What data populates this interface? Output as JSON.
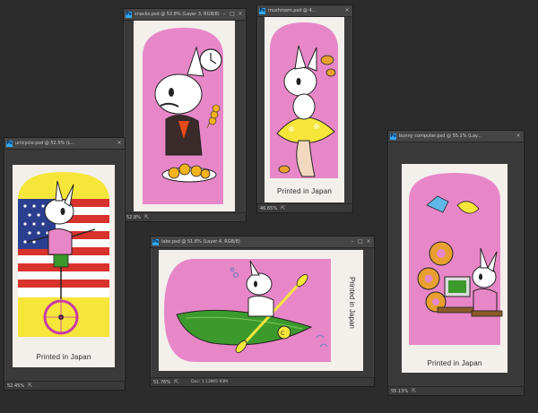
{
  "windows": {
    "snacks": {
      "title": "snacks.psd @ 52.8% (Layer 3, RGB/8)",
      "zoom": "52.8%"
    },
    "mushroom": {
      "title": "mushroom.psd @ 4...",
      "zoom": "46.65%",
      "caption": "Printed in Japan"
    },
    "unicycle": {
      "title": "unicycle.psd @ 52.5% (L...",
      "zoom": "52.45%",
      "caption": "Printed in Japan"
    },
    "lake": {
      "title": "lake.psd @ 51.8% (Layer 4, RGB/8)",
      "zoom": "51.76%",
      "doc": "Doc: 1.13M/5.93M",
      "caption": "Printed in Japan"
    },
    "computer": {
      "title": "bunny computer.psd @ 55.1% (Lay...",
      "zoom": "55.13%",
      "caption": "Printed in Japan"
    }
  },
  "colors": {
    "ps_bg": "#2c2c2c",
    "pink": "#e887c8",
    "yellow": "#f6e63a",
    "green": "#3c9a2c"
  }
}
